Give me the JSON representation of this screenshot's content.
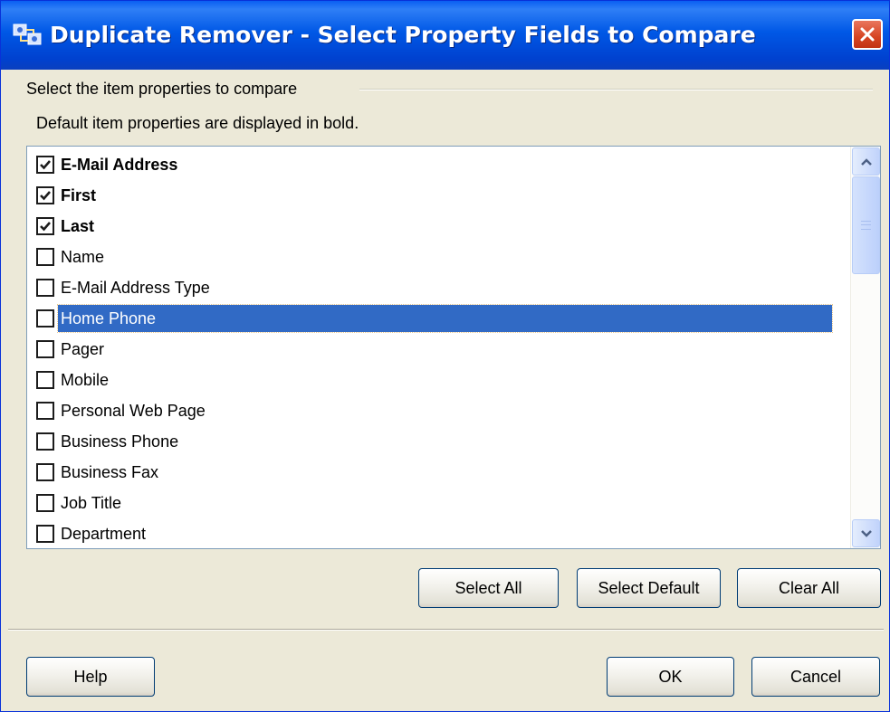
{
  "window": {
    "title": "Duplicate Remover - Select Property Fields to Compare",
    "title_icon": "app-icon",
    "close_icon": "close-icon"
  },
  "group": {
    "label": "Select the item properties to compare",
    "hint": "Default item properties are displayed in bold."
  },
  "properties": [
    {
      "label": "E-Mail Address",
      "checked": true,
      "bold": true
    },
    {
      "label": "First",
      "checked": true,
      "bold": true
    },
    {
      "label": "Last",
      "checked": true,
      "bold": true
    },
    {
      "label": "Name",
      "checked": false,
      "bold": false
    },
    {
      "label": "E-Mail Address Type",
      "checked": false,
      "bold": false
    },
    {
      "label": "Home Phone",
      "checked": false,
      "bold": false,
      "selected": true
    },
    {
      "label": "Pager",
      "checked": false,
      "bold": false
    },
    {
      "label": "Mobile",
      "checked": false,
      "bold": false
    },
    {
      "label": "Personal Web Page",
      "checked": false,
      "bold": false
    },
    {
      "label": "Business Phone",
      "checked": false,
      "bold": false
    },
    {
      "label": "Business Fax",
      "checked": false,
      "bold": false
    },
    {
      "label": "Job Title",
      "checked": false,
      "bold": false
    },
    {
      "label": "Department",
      "checked": false,
      "bold": false
    }
  ],
  "list_buttons": {
    "select_all": "Select All",
    "select_default": "Select Default",
    "clear_all": "Clear All"
  },
  "footer_buttons": {
    "help": "Help",
    "ok": "OK",
    "cancel": "Cancel"
  },
  "colors": {
    "title_bar": "#0058e6",
    "selection": "#316ac5",
    "dialog_bg": "#ece9d8",
    "close_button": "#d64422"
  }
}
